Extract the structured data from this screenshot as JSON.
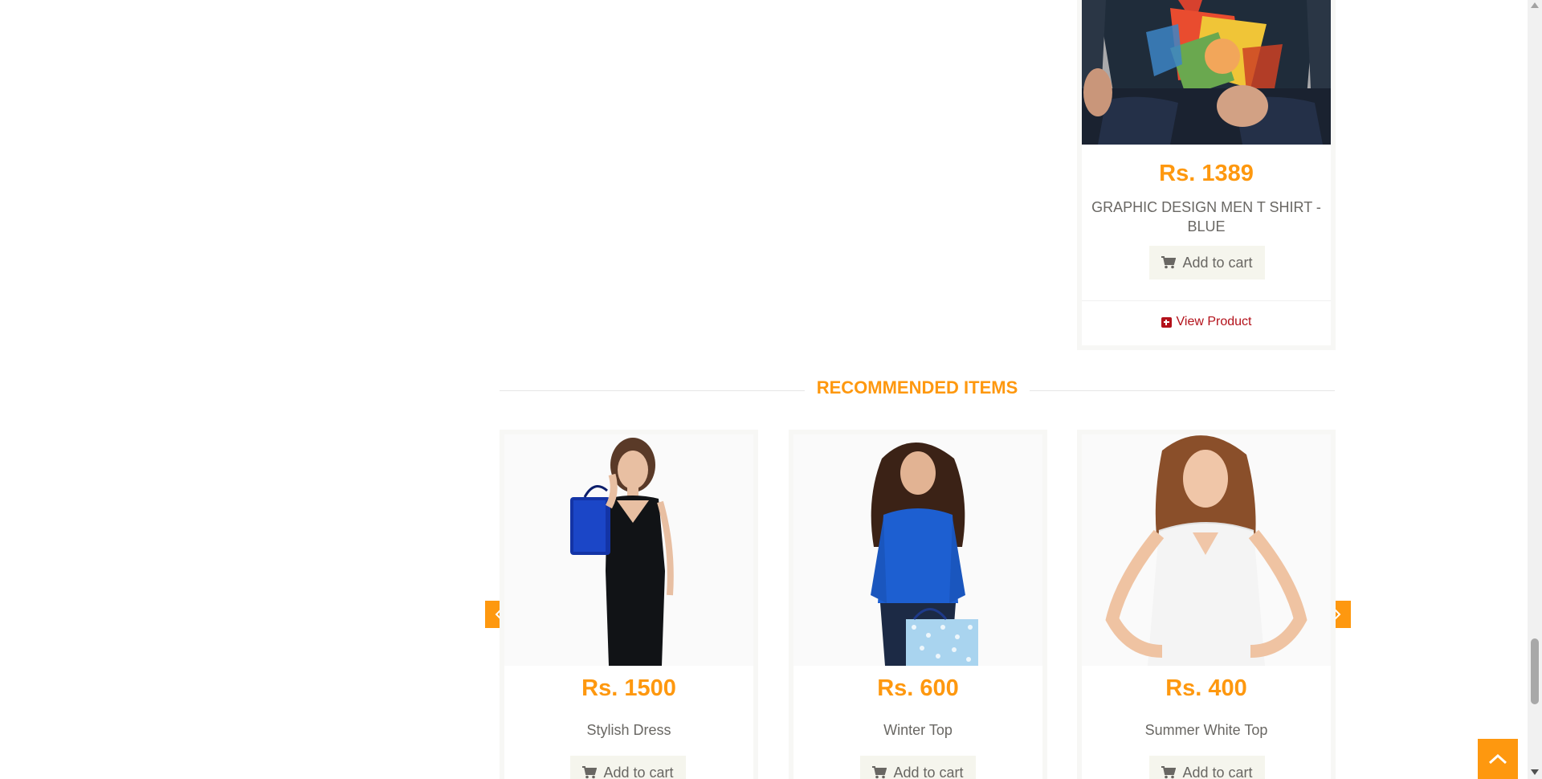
{
  "top_product": {
    "price": "Rs. 1389",
    "name": "GRAPHIC DESIGN MEN T SHIRT - BLUE",
    "add_to_cart": "Add to cart",
    "view_product": "View Product"
  },
  "recommended": {
    "title": "RECOMMENDED ITEMS",
    "items": [
      {
        "price": "Rs. 1500",
        "name": "Stylish Dress",
        "add_to_cart": "Add to cart"
      },
      {
        "price": "Rs. 600",
        "name": "Winter Top",
        "add_to_cart": "Add to cart"
      },
      {
        "price": "Rs. 400",
        "name": "Summer White Top",
        "add_to_cart": "Add to cart"
      }
    ]
  },
  "colors": {
    "accent": "#FE980F",
    "link": "#B3111A",
    "text": "#696763",
    "button_bg": "#F5F5ED"
  },
  "icons": [
    "cart-icon",
    "plus-square-icon",
    "chevron-left-icon",
    "chevron-right-icon",
    "chevron-up-icon"
  ]
}
